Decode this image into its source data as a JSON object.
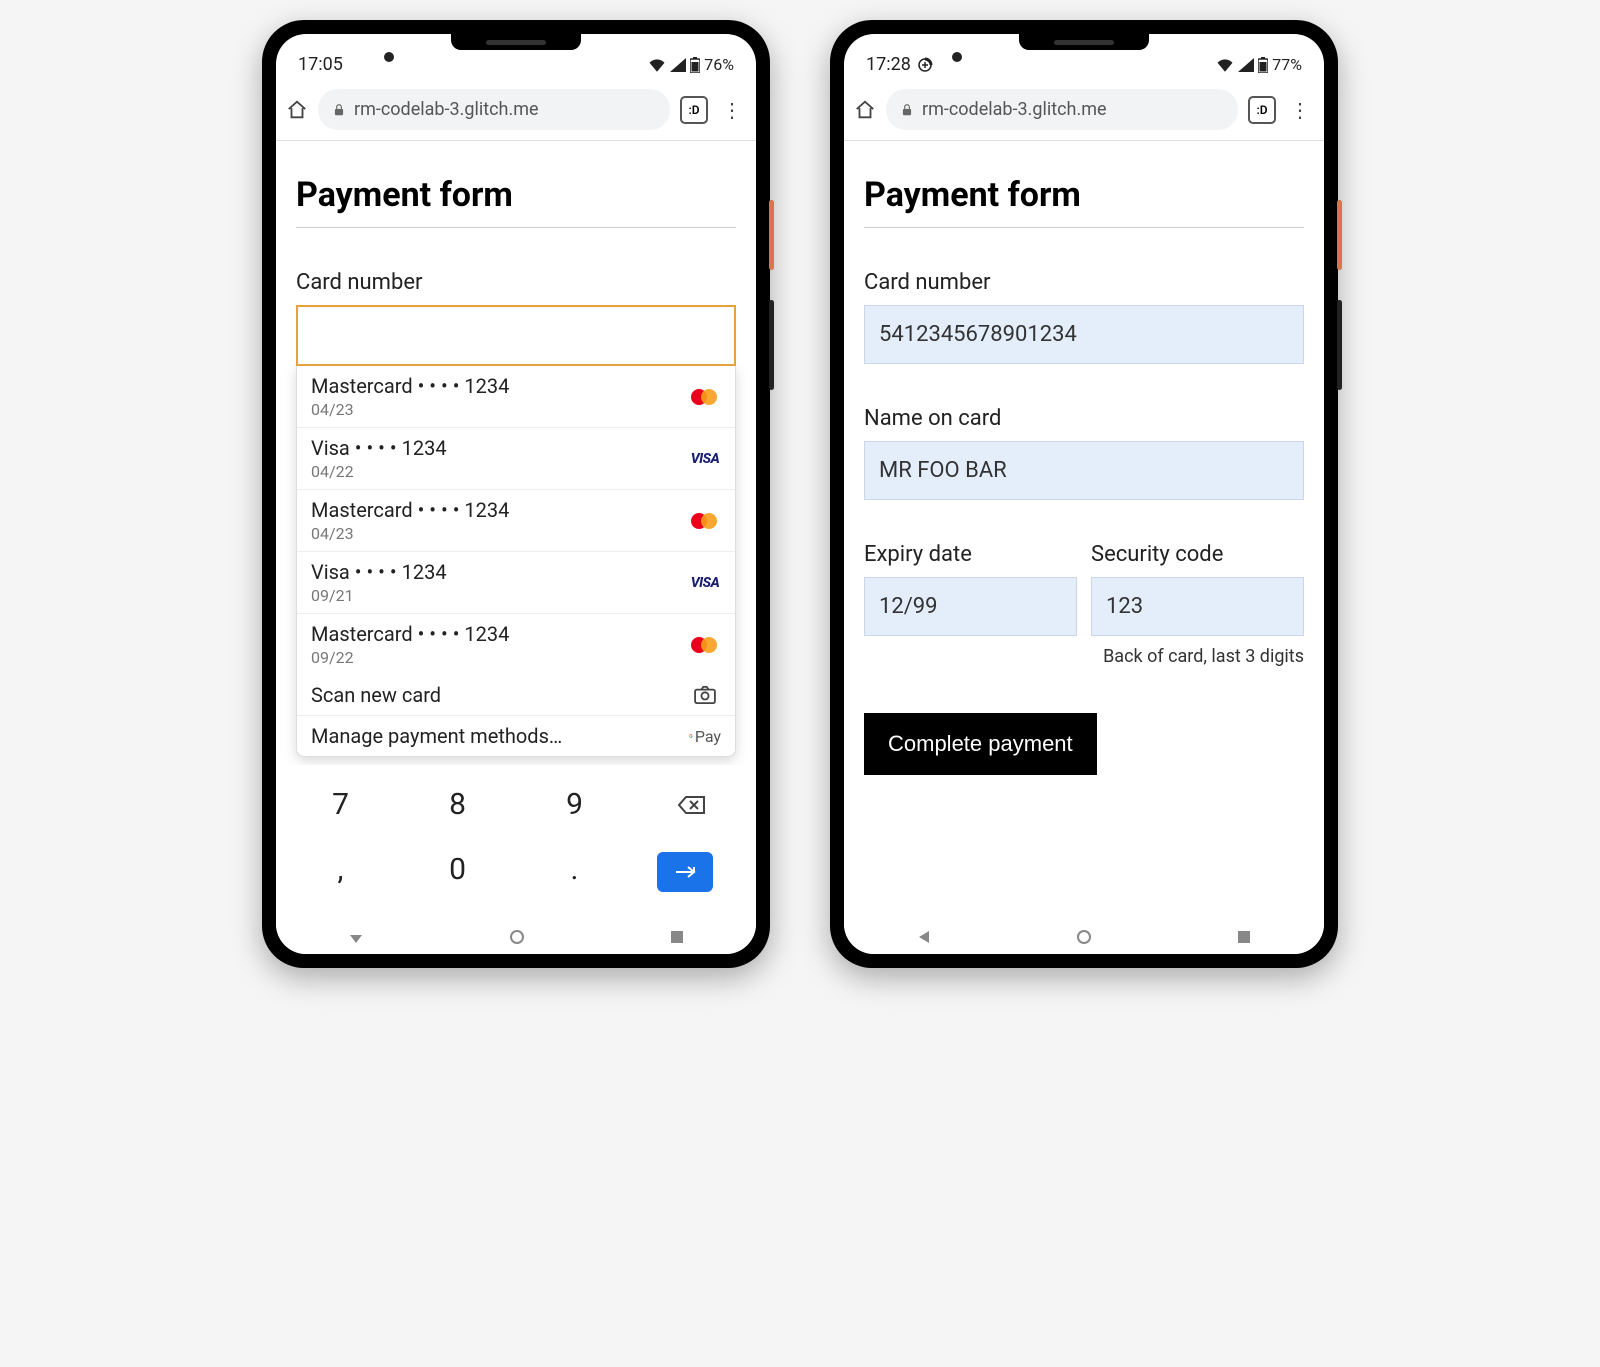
{
  "phone1": {
    "status": {
      "time": "17:05",
      "battery": "76%",
      "wifi": true,
      "signal": true
    },
    "browser": {
      "url": "rm-codelab-3.glitch.me",
      "tab_label": ":D"
    },
    "page": {
      "title": "Payment form"
    },
    "fields": {
      "card_number_label": "Card number"
    },
    "autofill": {
      "cards": [
        {
          "brand": "Mastercard",
          "masked": "• • • • 1234",
          "expiry": "04/23",
          "logo": "mastercard"
        },
        {
          "brand": "Visa",
          "masked": "• • • • 1234",
          "expiry": "04/22",
          "logo": "visa"
        },
        {
          "brand": "Mastercard",
          "masked": "• • • • 1234",
          "expiry": "04/23",
          "logo": "mastercard"
        },
        {
          "brand": "Visa",
          "masked": "• • • • 1234",
          "expiry": "09/21",
          "logo": "visa"
        },
        {
          "brand": "Mastercard",
          "masked": "• • • • 1234",
          "expiry": "09/22",
          "logo": "mastercard"
        }
      ],
      "scan_label": "Scan new card",
      "manage_label": "Manage payment methods…"
    },
    "keyboard": {
      "row1": [
        "7",
        "8",
        "9"
      ],
      "row2": [
        ",",
        "0",
        "."
      ],
      "backspace": "backspace-icon",
      "enter": "enter-icon"
    }
  },
  "phone2": {
    "status": {
      "time": "17:28",
      "battery": "77%",
      "datasaver": true
    },
    "browser": {
      "url": "rm-codelab-3.glitch.me",
      "tab_label": ":D"
    },
    "page": {
      "title": "Payment form"
    },
    "fields": {
      "card_number_label": "Card number",
      "card_number_value": "5412345678901234",
      "name_label": "Name on card",
      "name_value": "MR FOO BAR",
      "expiry_label": "Expiry date",
      "expiry_value": "12/99",
      "cvc_label": "Security code",
      "cvc_value": "123",
      "cvc_helper": "Back of card, last 3 digits",
      "submit_label": "Complete payment"
    }
  },
  "icons": {
    "gpay_text": "Pay"
  }
}
